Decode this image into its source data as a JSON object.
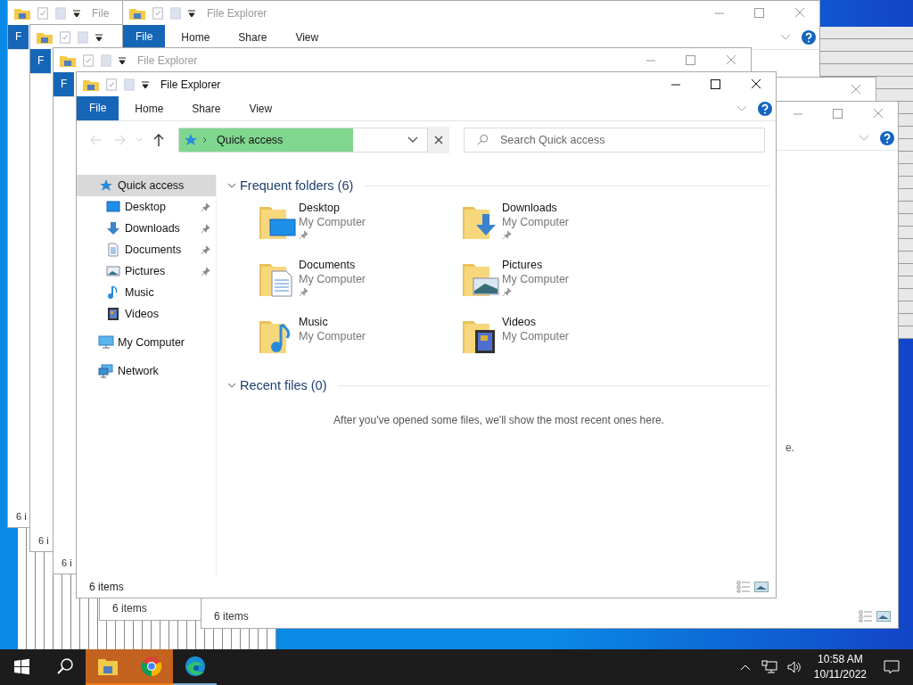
{
  "background_windows": [
    {
      "active": false,
      "title": "File",
      "tabs": [
        {
          "label": "F",
          "kind": "file"
        }
      ],
      "status": "6 i"
    },
    {
      "tabs": [
        {
          "label": "F",
          "kind": "file"
        }
      ],
      "status": "6 i"
    },
    {
      "active": false,
      "title": "File Explorer",
      "tabs": [
        {
          "label": "File",
          "kind": "file"
        },
        {
          "label": "Home",
          "kind": "tab"
        },
        {
          "label": "Share",
          "kind": "tab"
        },
        {
          "label": "View",
          "kind": "tab"
        }
      ]
    },
    {
      "active": false,
      "title": "File Explorer",
      "tabs": [
        {
          "label": "F",
          "kind": "file"
        }
      ],
      "status": "6 i"
    },
    {
      "status": "6 items"
    },
    {
      "active": false
    },
    {
      "active": false,
      "message": "e.",
      "status": "6 items"
    }
  ],
  "window": {
    "title": "File Explorer",
    "active": true,
    "tabs": [
      {
        "label": "File",
        "kind": "file"
      },
      {
        "label": "Home",
        "kind": "tab"
      },
      {
        "label": "Share",
        "kind": "tab"
      },
      {
        "label": "View",
        "kind": "tab"
      }
    ],
    "address": {
      "location": "Quick access",
      "level": 0.7
    },
    "search": {
      "placeholder": "Search Quick access"
    },
    "nav": [
      {
        "label": "Quick access",
        "selected": true,
        "children": [
          {
            "label": "Desktop",
            "selected": false,
            "pinned": true
          },
          {
            "label": "Downloads",
            "selected": false,
            "pinned": true
          },
          {
            "label": "Documents",
            "selected": false,
            "pinned": true
          },
          {
            "label": "Pictures",
            "selected": false,
            "pinned": true
          },
          {
            "label": "Music",
            "selected": false,
            "pinned": false
          },
          {
            "label": "Videos",
            "selected": false,
            "pinned": false
          }
        ]
      },
      {
        "label": "My Computer",
        "selected": false
      },
      {
        "label": "Network",
        "selected": false
      }
    ],
    "frequent": {
      "heading": "Frequent folders (6)",
      "expanded": true,
      "folders": [
        {
          "name": "Desktop",
          "location": "My Computer",
          "pinned": true
        },
        {
          "name": "Downloads",
          "location": "My Computer",
          "pinned": true
        },
        {
          "name": "Documents",
          "location": "My Computer",
          "pinned": true
        },
        {
          "name": "Pictures",
          "location": "My Computer",
          "pinned": true
        },
        {
          "name": "Music",
          "location": "My Computer",
          "pinned": false
        },
        {
          "name": "Videos",
          "location": "My Computer",
          "pinned": false
        }
      ]
    },
    "recent": {
      "heading": "Recent files (0)",
      "expanded": true,
      "message": "After you've opened some files, we'll show the most recent ones here."
    },
    "status": "6 items"
  },
  "taskbar": {
    "apps": [
      {
        "flashing": true,
        "running": true
      },
      {
        "flashing": true,
        "running": true
      },
      {
        "flashing": false,
        "running": true
      }
    ],
    "clock": {
      "time": "10:58 AM",
      "date": "10/11/2022"
    }
  }
}
